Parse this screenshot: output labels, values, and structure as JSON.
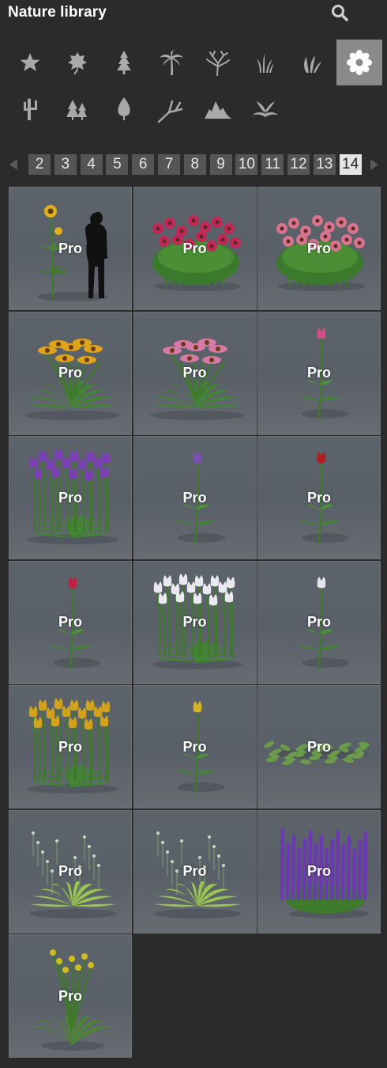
{
  "header": {
    "title": "Nature library",
    "search_icon": "search-icon"
  },
  "categories": [
    {
      "icon": "star-icon",
      "active": false
    },
    {
      "icon": "leaf-icon",
      "active": false
    },
    {
      "icon": "conifer-tree-icon",
      "active": false
    },
    {
      "icon": "palm-tree-icon",
      "active": false
    },
    {
      "icon": "bare-tree-icon",
      "active": false
    },
    {
      "icon": "grass-icon",
      "active": false
    },
    {
      "icon": "bush-leaves-icon",
      "active": false
    },
    {
      "icon": "flower-icon",
      "active": true
    },
    {
      "icon": "cactus-icon",
      "active": false
    },
    {
      "icon": "forest-icon",
      "active": false
    },
    {
      "icon": "single-leaf-icon",
      "active": false
    },
    {
      "icon": "branch-icon",
      "active": false
    },
    {
      "icon": "rocks-icon",
      "active": false
    },
    {
      "icon": "fern-icon",
      "active": false
    }
  ],
  "pagination": {
    "prev_icon": "chevron-left-icon",
    "next_icon": "chevron-right-icon",
    "pages": [
      "2",
      "3",
      "4",
      "5",
      "6",
      "7",
      "8",
      "9",
      "10",
      "11",
      "12",
      "13",
      "14"
    ],
    "current": "14"
  },
  "items": [
    {
      "badge": "Pro",
      "kind": "sunflower",
      "color": "#e0b21c"
    },
    {
      "badge": "Pro",
      "kind": "shrub",
      "color": "#c2275a"
    },
    {
      "badge": "Pro",
      "kind": "shrub",
      "color": "#d7738f"
    },
    {
      "badge": "Pro",
      "kind": "daisy",
      "color": "#e0a31c"
    },
    {
      "badge": "Pro",
      "kind": "daisy",
      "color": "#d77aa6"
    },
    {
      "badge": "Pro",
      "kind": "single-tulip",
      "color": "#cf4f84"
    },
    {
      "badge": "Pro",
      "kind": "tulip-cluster",
      "color": "#7a3fb3"
    },
    {
      "badge": "Pro",
      "kind": "single-tulip",
      "color": "#7a4fb3"
    },
    {
      "badge": "Pro",
      "kind": "single-tulip",
      "color": "#b31d22"
    },
    {
      "badge": "Pro",
      "kind": "single-tulip",
      "color": "#c01f3e"
    },
    {
      "badge": "Pro",
      "kind": "tulip-cluster",
      "color": "#e9e9ef"
    },
    {
      "badge": "Pro",
      "kind": "single-tulip",
      "color": "#e6e6ea"
    },
    {
      "badge": "Pro",
      "kind": "tulip-cluster",
      "color": "#d3a21c"
    },
    {
      "badge": "Pro",
      "kind": "single-tulip",
      "color": "#d8b41e"
    },
    {
      "badge": "Pro",
      "kind": "ground-cover",
      "color": "#6a9a4b"
    },
    {
      "badge": "Pro",
      "kind": "leafy-plant",
      "color": "#9fd04c"
    },
    {
      "badge": "Pro",
      "kind": "leafy-plant",
      "color": "#9fd04c"
    },
    {
      "badge": "Pro",
      "kind": "salvia",
      "color": "#6b3ab0"
    },
    {
      "badge": "Pro",
      "kind": "yellow-wildflower",
      "color": "#cfbd22"
    }
  ]
}
